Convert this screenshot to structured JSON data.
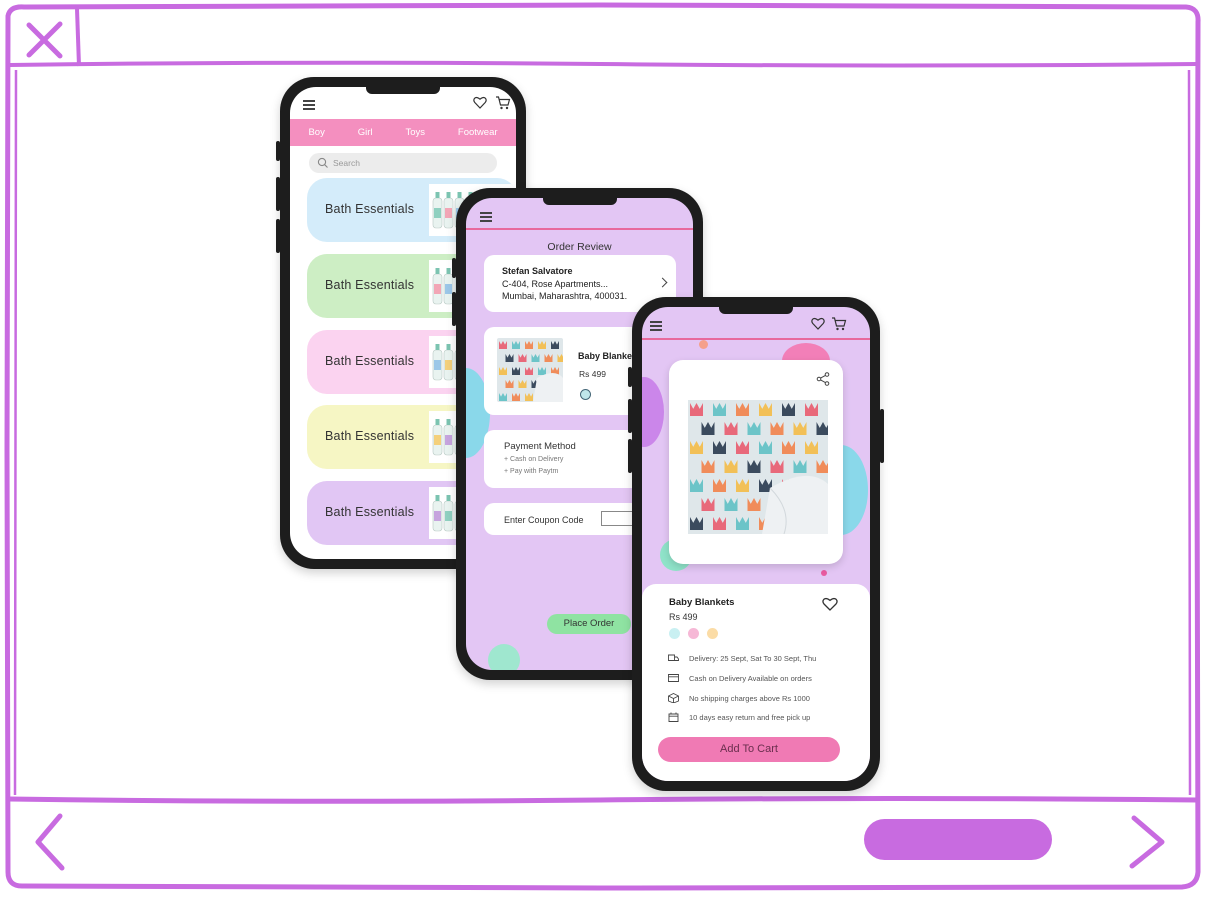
{
  "colors": {
    "frame": "#c86be0",
    "accent_pink": "#f48fbf",
    "screen_lavender": "#e3c6f4",
    "place_order_green": "#8fe3a2",
    "add_to_cart_pink": "#f07ab4"
  },
  "browser": {
    "close_icon": "close-icon",
    "back_icon": "chevron-left-icon",
    "forward_icon": "chevron-right-icon"
  },
  "phone1": {
    "tabs": [
      "Boy",
      "Girl",
      "Toys",
      "Footwear"
    ],
    "search_placeholder": "Search",
    "categories": [
      {
        "label": "Bath Essentials",
        "color": "#d4ecfa"
      },
      {
        "label": "Bath Essentials",
        "color": "#cdeec4"
      },
      {
        "label": "Bath Essentials",
        "color": "#fbd3f0"
      },
      {
        "label": "Bath Essentials",
        "color": "#f6f6c4"
      },
      {
        "label": "Bath Essentials",
        "color": "#e1c6f4"
      }
    ]
  },
  "phone2": {
    "title": "Order Review",
    "address": {
      "name": "Stefan Salvatore",
      "line1": "C-404, Rose Apartments...",
      "line2": "Mumbai, Maharashtra, 400031."
    },
    "item": {
      "name": "Baby Blankets",
      "price": "Rs 499"
    },
    "payment": {
      "title": "Payment Method",
      "options": [
        "+ Cash on Delivery",
        "+ Pay with Paytm"
      ]
    },
    "coupon_label": "Enter Coupon Code",
    "place_order_label": "Place Order"
  },
  "phone3": {
    "product_name": "Baby Blankets",
    "price": "Rs 499",
    "swatches": [
      "#c9f0f2",
      "#f6b8d6",
      "#fbdca6"
    ],
    "info": [
      {
        "icon": "truck-icon",
        "text": "Delivery: 25 Sept, Sat To 30 Sept, Thu"
      },
      {
        "icon": "card-icon",
        "text": "Cash on Delivery Available on orders"
      },
      {
        "icon": "box-icon",
        "text": "No shipping charges above Rs 1000"
      },
      {
        "icon": "calendar-icon",
        "text": "10 days easy return and free pick up"
      }
    ],
    "add_to_cart_label": "Add To Cart"
  }
}
